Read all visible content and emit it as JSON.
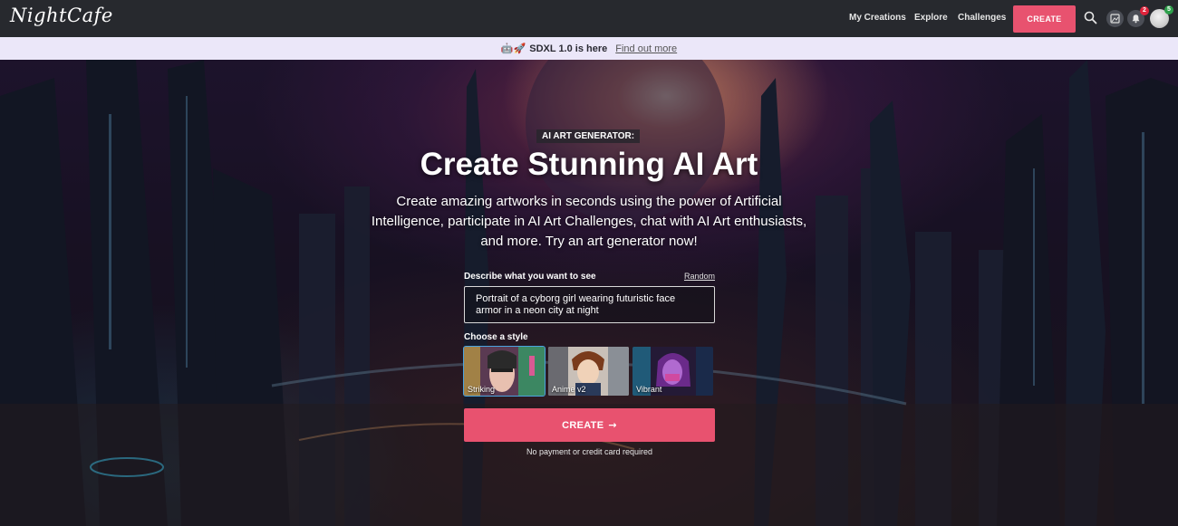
{
  "brand": {
    "logo_text": "NightCafe",
    "accent_color": "#e8526f"
  },
  "nav": {
    "links": [
      "My Creations",
      "Explore",
      "Challenges"
    ],
    "create_label": "CREATE",
    "icons": [
      "search-icon",
      "image-icon",
      "bell-icon",
      "avatar"
    ],
    "notification_count": "2",
    "avatar_badge": "5"
  },
  "announcement": {
    "emoji": "🤖🚀",
    "title": "SDXL 1.0 is here",
    "link": "Find out more"
  },
  "hero": {
    "kicker": "AI ART GENERATOR:",
    "headline": "Create Stunning AI Art",
    "subtext": "Create amazing artworks in seconds using the power of Artificial Intelligence, participate in AI Art Challenges, chat with AI Art enthusiasts, and more. Try an art generator now!"
  },
  "form": {
    "prompt_label": "Describe what you want to see",
    "random_label": "Random",
    "prompt_value": "Portrait of a cyborg girl wearing futuristic face armor in a neon city at night",
    "style_label": "Choose a style",
    "styles": [
      {
        "name": "Striking",
        "selected": true
      },
      {
        "name": "Anime v2",
        "selected": false
      },
      {
        "name": "Vibrant",
        "selected": false
      }
    ],
    "create_label": "CREATE",
    "create_arrow": "→",
    "no_payment": "No payment or credit card required"
  }
}
